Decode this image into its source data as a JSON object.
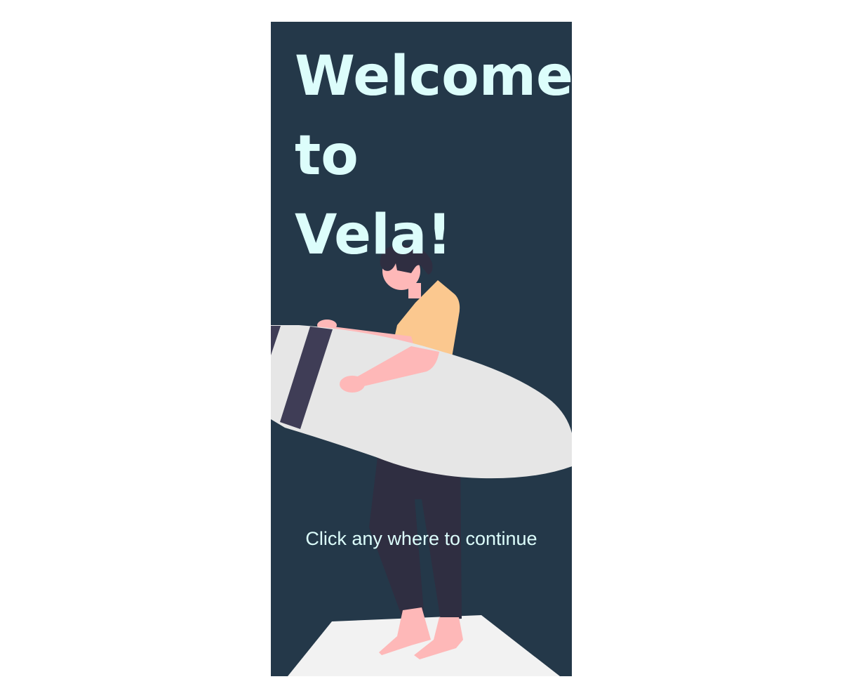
{
  "welcome": {
    "title_lines": [
      "Welcome",
      "to",
      "Vela!"
    ],
    "cta": "Click any where to continue"
  },
  "illustration": {
    "icon": "surfer-illustration",
    "colors": {
      "background": "#243849",
      "title_text": "#dcfdfb",
      "skin": "#feb8b8",
      "shirt": "#fbc88f",
      "hair_and_pants": "#2f2e41",
      "board": "#e6e6e6",
      "board_stripe": "#3f3d56",
      "floor": "#f2f2f2"
    }
  }
}
